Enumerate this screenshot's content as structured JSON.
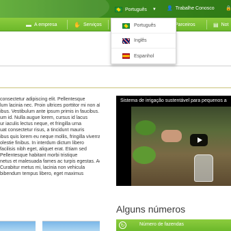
{
  "header": {
    "language": {
      "current": "Português",
      "caret": "▼",
      "flag_icon": "brazil-flag-icon"
    },
    "work_with_us": "Trabalhe Conosco",
    "work_icon": "user-add-icon",
    "lock_icon": "lock-icon"
  },
  "nav": {
    "items": [
      {
        "label": "A empresa",
        "icon": "briefcase-icon"
      },
      {
        "label": "Serviços",
        "icon": "hand-icon"
      },
      {
        "label": "Parceiros",
        "icon": "handshake-icon"
      },
      {
        "label": "Not",
        "icon": "news-icon"
      }
    ]
  },
  "language_menu": {
    "options": [
      {
        "label": "Português",
        "flag_icon": "brazil-flag-icon"
      },
      {
        "label": "Inglês",
        "flag_icon": "uk-flag-icon"
      },
      {
        "label": "Espanhol",
        "flag_icon": "spain-flag-icon"
      }
    ]
  },
  "content": {
    "paragraph_lines": [
      "consectetur adipiscing elit. Pellentesque",
      "lum lacinia nec. Proin ultrices porttitor mi non aliquet.",
      "ibus. Vestibulum ante ipsum primis in faucibus. Sed tincidunt",
      "um id. Nulla augue lorem, cursus id lacus",
      "ur iaculis lectus neque, et fringilla urna",
      "uat consectetur risus, a tincidunt mauris",
      "ibus quis lorem eu neque mollis, fringilla viverra odio",
      "olestie finibus. In interdum dictum libero",
      "facilisis nibh eget, aliquet erat. Etiam sed",
      "Pellentesque habitant morbi tristique",
      "netus et malesuada fames ac turpis egestas. Aenean vel urna el",
      "Curabitur metus mi, lacinia non vehicula",
      "bibendum tempus libero, eget maximus"
    ]
  },
  "video": {
    "title": "Sistema de irrigação sustentável para pequenos a"
  },
  "numbers": {
    "title": "Alguns números",
    "bar_label": "Número de fazendas",
    "bar_icon": "refresh-icon"
  },
  "colors": {
    "primary_green": "#3c8b1f",
    "nav_green": "#7cc234",
    "olive_line": "#c9c27a"
  }
}
